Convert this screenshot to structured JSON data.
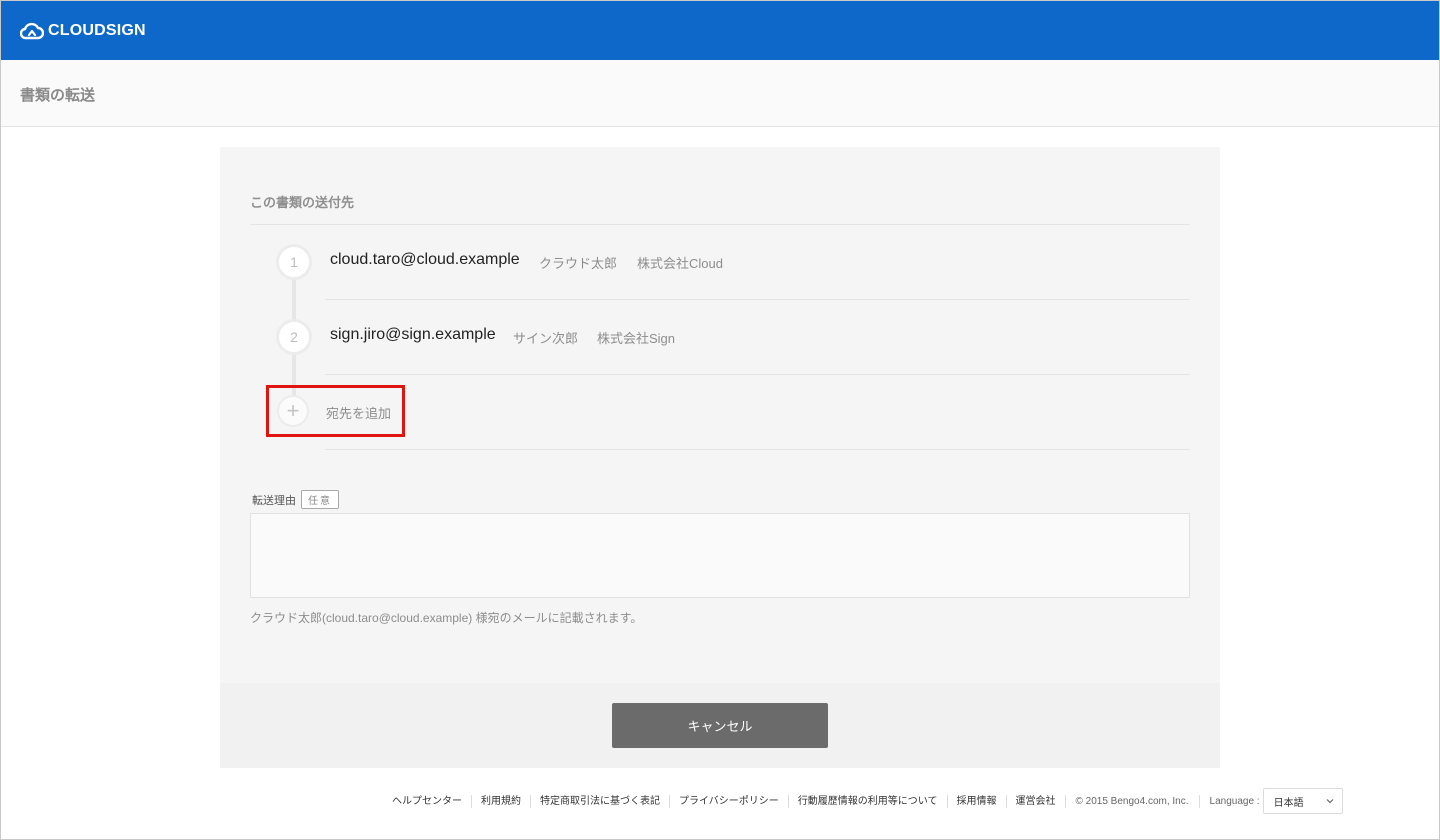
{
  "header": {
    "logo_text": "CLOUDSIGN",
    "brand_color": "#0d68c9"
  },
  "page": {
    "title": "書類の転送"
  },
  "recipients_section": {
    "title": "この書類の送付先",
    "recipients": [
      {
        "step": "1",
        "email": "cloud.taro@cloud.example",
        "name": "クラウド太郎",
        "company": "株式会社Cloud"
      },
      {
        "step": "2",
        "email": "sign.jiro@sign.example",
        "name": "サイン次郎",
        "company": "株式会社Sign"
      }
    ],
    "add_icon": "plus-icon",
    "add_label": "宛先を追加",
    "highlight_color": "#e0150f"
  },
  "reason": {
    "label": "転送理由",
    "optional_badge": "任意",
    "value": "",
    "helper_text": "クラウド太郎(cloud.taro@cloud.example) 様宛のメールに記載されます。"
  },
  "actions": {
    "cancel_label": "キャンセル"
  },
  "footer": {
    "links": [
      "ヘルプセンター",
      "利用規約",
      "特定商取引法に基づく表記",
      "プライバシーポリシー",
      "行動履歴情報の利用等について",
      "採用情報",
      "運営会社"
    ],
    "copyright": "© 2015 Bengo4.com, Inc.",
    "language_label": "Language :",
    "language_value": "日本語"
  }
}
